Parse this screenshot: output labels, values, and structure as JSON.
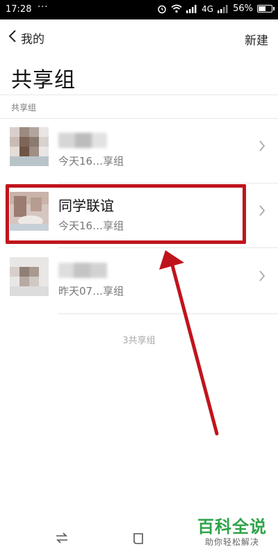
{
  "status_bar": {
    "time": "17:28",
    "dots": "···",
    "network": "4G",
    "battery": "56%",
    "battery_level": 0.56
  },
  "header": {
    "back_label": "我的",
    "new_label": "新建",
    "title": "共享组"
  },
  "section_label": "共享组",
  "groups": [
    {
      "title": "",
      "subtitle": "今天16…享组",
      "blurred_title": true
    },
    {
      "title": "同学联谊",
      "subtitle": "今天16…享组",
      "blurred_title": false
    },
    {
      "title": "",
      "subtitle": "昨天07…享组",
      "blurred_title": true
    }
  ],
  "count_label": "3共享组",
  "watermark": {
    "brand": "百科全说",
    "tagline": "助你轻松解决"
  },
  "colors": {
    "highlight": "#c0141c",
    "watermark_green": "#2fa34a"
  }
}
